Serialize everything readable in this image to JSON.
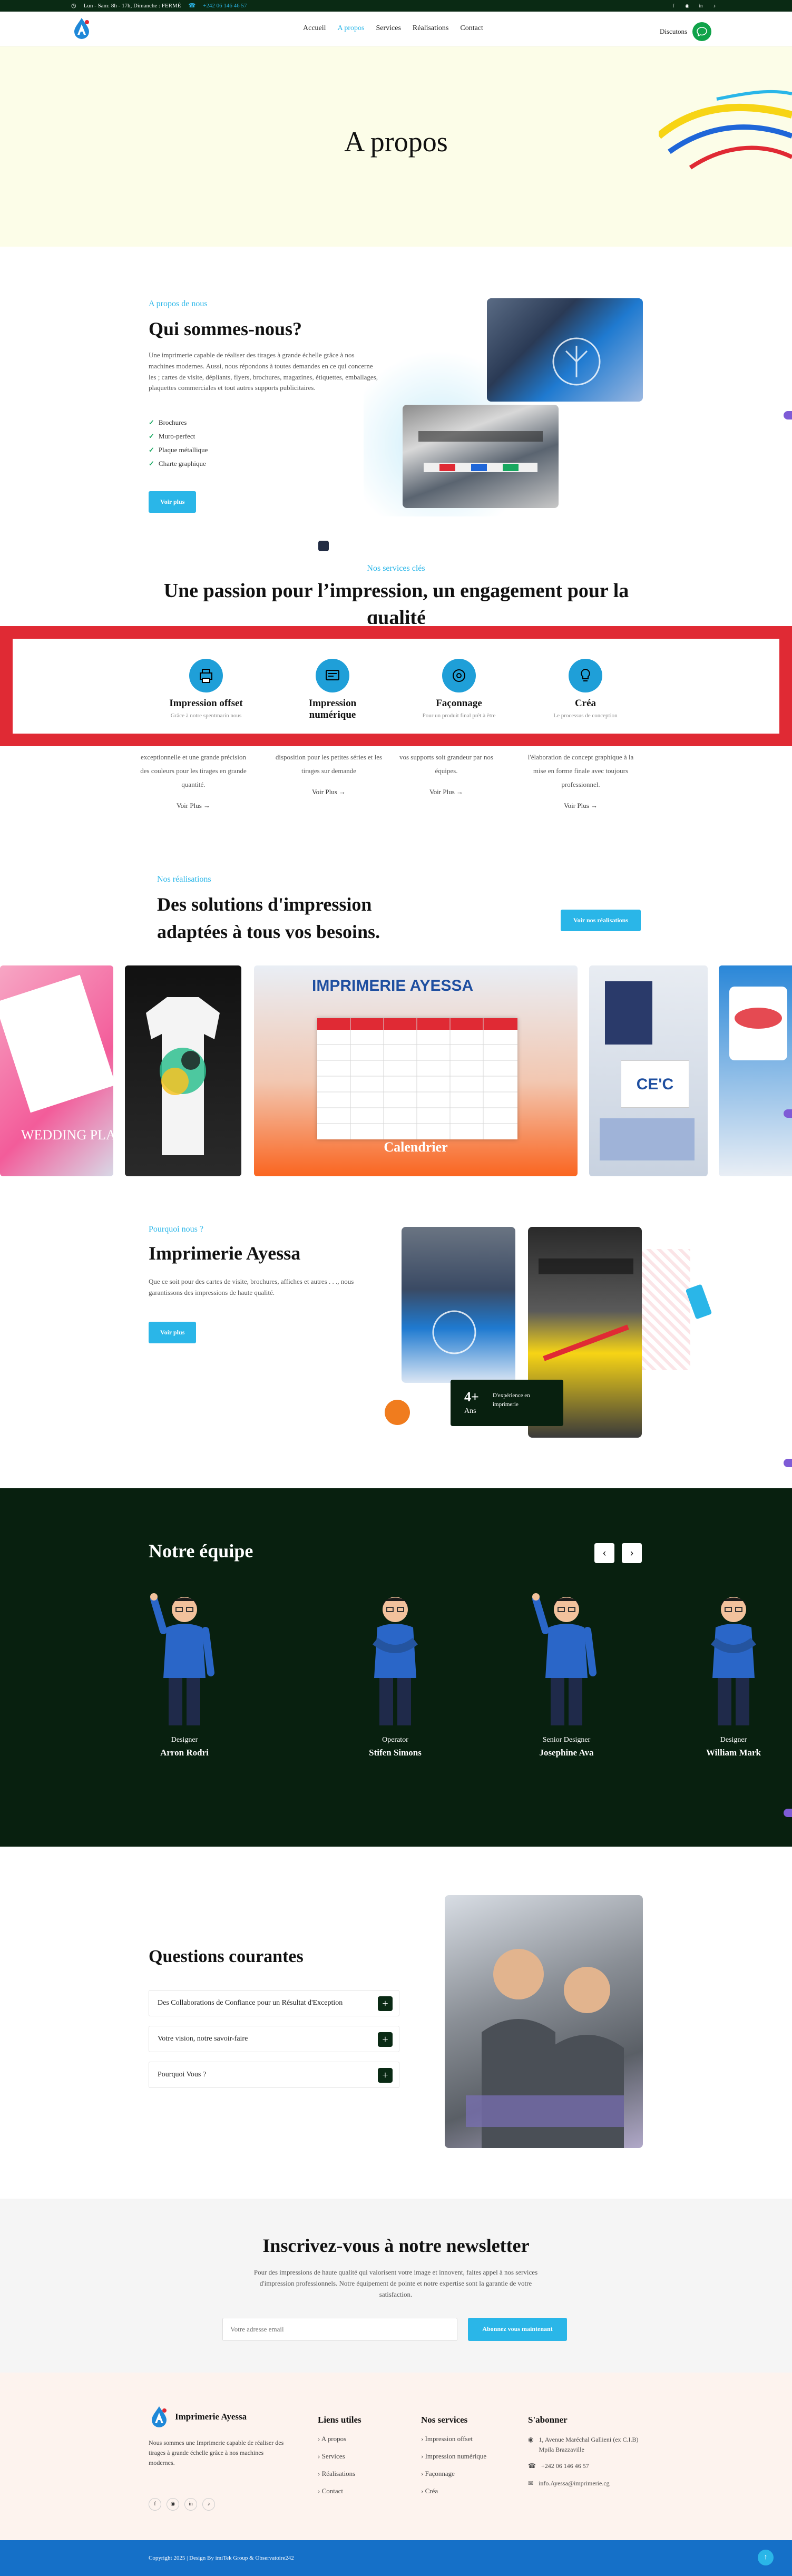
{
  "topbar": {
    "hours": "Lun - Sam: 8h - 17h, Dimanche : FERMÉ",
    "phone": "+242 06 146 46 57",
    "socials": [
      "facebook-icon",
      "instagram-icon",
      "linkedin-icon",
      "tiktok-icon"
    ]
  },
  "nav": {
    "items": [
      "Accueil",
      "A propos",
      "Services",
      "Réalisations",
      "Contact"
    ],
    "active": "A propos",
    "discuss_label": "Discutons"
  },
  "hero": {
    "title": "A propos"
  },
  "about": {
    "eyebrow": "A propos de nous",
    "title": "Qui sommes-nous?",
    "text": "Une imprimerie capable de réaliser des tirages à grande échelle grâce à nos machines modernes. Aussi, nous répondons à toutes demandes en ce qui concerne les ; cartes de visite, dépliants, flyers, brochures, magazines, étiquettes, emballages, plaquettes commerciales et tout autres supports publicitaires.",
    "checks": [
      "Brochures",
      "Muro-perfect",
      "Plaque métallique",
      "Charte graphique"
    ],
    "button": "Voir plus"
  },
  "services": {
    "eyebrow": "Nos services clés",
    "title": "Une passion pour l’impression, un engagement pour la qualité",
    "items": [
      {
        "title": "Impression offset",
        "desc": "Grâce à notre spentmarin nous",
        "below": "exceptionnelle et une grande précision des couleurs pour les tirages en grande quantité.",
        "link": "Voir Plus"
      },
      {
        "title": "Impression numérique",
        "desc": "",
        "below": "disposition pour les petites séries et les tirages sur demande",
        "link": "Voir Plus"
      },
      {
        "title": "Façonnage",
        "desc": "Pour un produit final prêt à être",
        "below": "vos supports soit grandeur par nos équipes.",
        "link": "Voir Plus"
      },
      {
        "title": "Créa",
        "desc": "Le processus de conception",
        "below": "l'élaboration de concept graphique à la mise en forme finale avec toujours professionnel.",
        "link": "Voir Plus"
      }
    ]
  },
  "realisations": {
    "eyebrow": "Nos réalisations",
    "title": "Des solutions d'impression adaptées à tous vos besoins.",
    "button": "Voir nos réalisations",
    "gallery_caption": "Calendrier",
    "banner_text": "IMPRIMERIE AYESSA",
    "card_text": "CE'C",
    "wedding_text": "WEDDING PLANNER"
  },
  "why": {
    "eyebrow": "Pourquoi nous ?",
    "title": "Imprimerie Ayessa",
    "text": "Que ce soit pour des cartes de visite, brochures, affiches et autres . . ., nous garantissons des impressions de haute qualité.",
    "button": "Voir plus",
    "badge_num": "4+",
    "badge_unit": "Ans",
    "badge_text": "D'expérience en imprimerie"
  },
  "team": {
    "title": "Notre équipe",
    "members": [
      {
        "role": "Designer",
        "name": "Arron Rodri"
      },
      {
        "role": "Operator",
        "name": "Stifen Simons"
      },
      {
        "role": "Senior Designer",
        "name": "Josephine Ava"
      },
      {
        "role": "Designer",
        "name": "William Mark"
      }
    ]
  },
  "faq": {
    "title": "Questions courantes",
    "items": [
      "Des Collaborations de Confiance pour un Résultat d'Exception",
      "Votre vision, notre savoir-faire",
      "Pourquoi Vous ?"
    ]
  },
  "newsletter": {
    "title": "Inscrivez-vous à notre newsletter",
    "text": "Pour des impressions de haute qualité qui valorisent votre image et innovent, faites appel à nos services d'impression professionnels. Notre équipement de pointe et notre expertise sont la garantie de votre satisfaction.",
    "placeholder": "Votre adresse email",
    "button": "Abonnez vous maintenant"
  },
  "footer": {
    "brand": "Imprimerie Ayessa",
    "about": "Nous sommes une Imprimerie capable de réaliser des tirages à grande échelle grâce à nos machines modernes.",
    "links_title": "Liens utiles",
    "links": [
      "A propos",
      "Services",
      "Réalisations",
      "Contact"
    ],
    "services_title": "Nos services",
    "services": [
      "Impression offset",
      "Impression numérique",
      "Façonnage",
      "Créa"
    ],
    "subscribe_title": "S'abonner",
    "address": "1, Avenue Maréchal Gallieni (ex C.I.B) Mpila Brazzaville",
    "phone": "+242 06 146 46 57",
    "email": "info.Ayessa@imprimerie.cg",
    "copyright": "Copyright 2025 | Design By imiTek Group & Observatoire242"
  },
  "colors": {
    "accent": "#2ab6e8",
    "dark_green": "#08200f",
    "red_band": "#e02a34",
    "hero_bg": "#fcfde8"
  }
}
